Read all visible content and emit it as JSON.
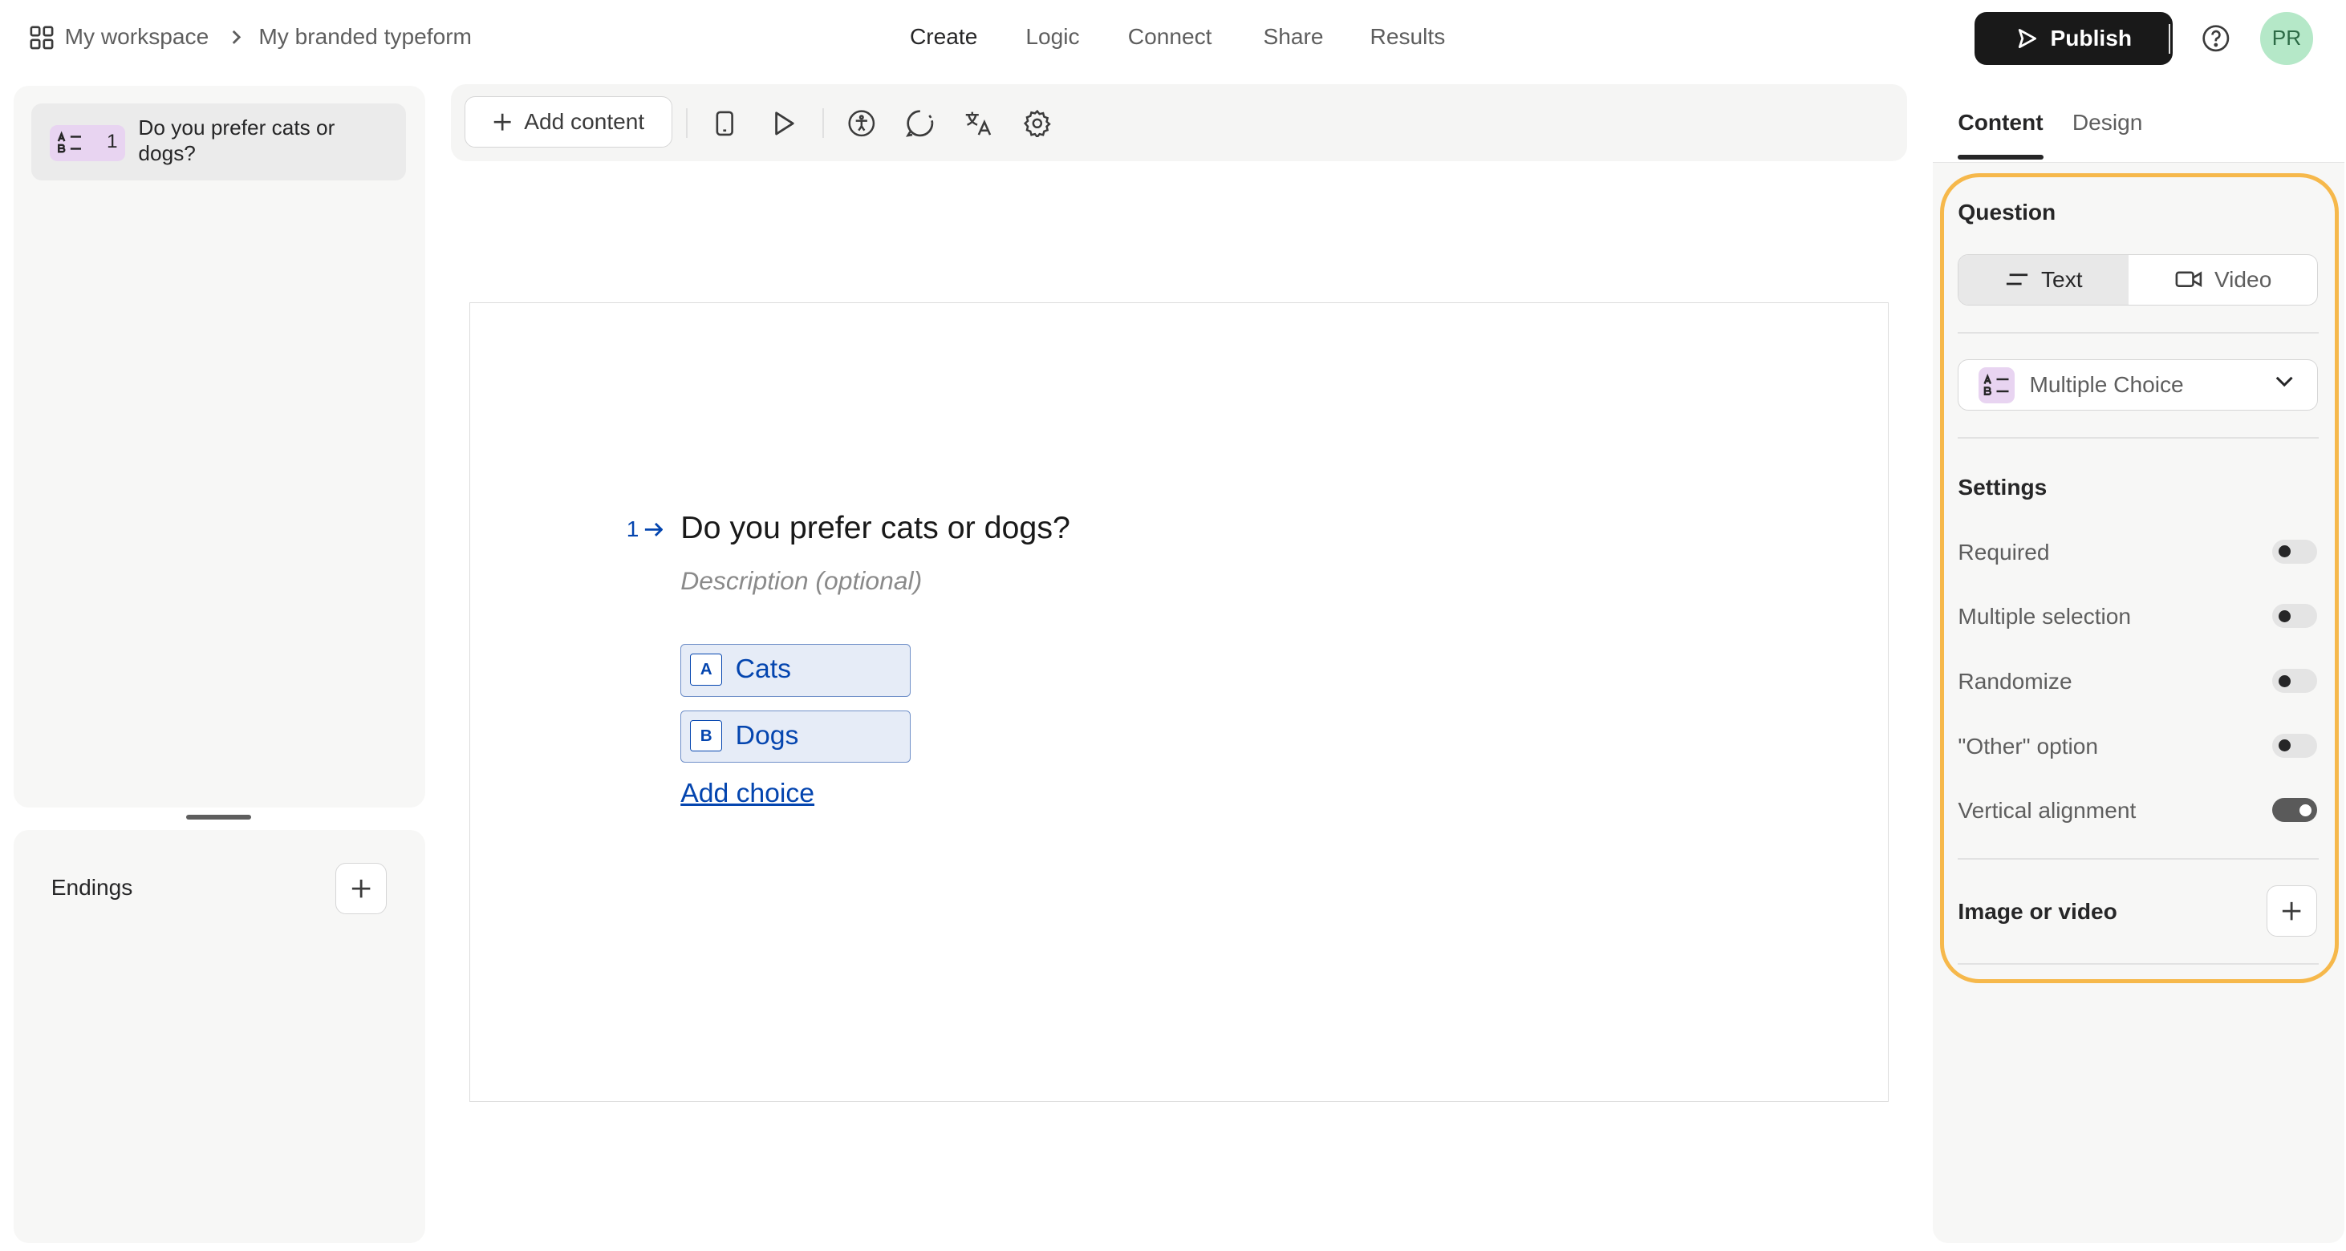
{
  "header": {
    "workspace": "My workspace",
    "form_name": "My branded typeform",
    "nav": [
      "Create",
      "Logic",
      "Connect",
      "Share",
      "Results"
    ],
    "active_nav": "Create",
    "publish_label": "Publish",
    "avatar_initials": "PR"
  },
  "sidebar": {
    "questions": [
      {
        "number": "1",
        "title": "Do you prefer cats or dogs?",
        "type_icon": "multiple-choice-icon"
      }
    ],
    "endings_label": "Endings"
  },
  "toolbar": {
    "add_content_label": "Add content",
    "icons": [
      "mobile-preview-icon",
      "play-icon",
      "accessibility-icon",
      "loading-icon",
      "translate-icon",
      "settings-icon"
    ]
  },
  "question": {
    "number": "1",
    "title": "Do you prefer cats or dogs?",
    "description_placeholder": "Description (optional)",
    "choices": [
      {
        "key": "A",
        "label": "Cats"
      },
      {
        "key": "B",
        "label": "Dogs"
      }
    ],
    "add_choice_label": "Add choice"
  },
  "panel": {
    "tabs": [
      "Content",
      "Design"
    ],
    "active_tab": "Content",
    "question_label": "Question",
    "question_modes": [
      "Text",
      "Video"
    ],
    "active_mode": "Text",
    "question_type": "Multiple Choice",
    "settings_label": "Settings",
    "settings": [
      {
        "label": "Required",
        "on": false
      },
      {
        "label": "Multiple selection",
        "on": false
      },
      {
        "label": "Randomize",
        "on": false
      },
      {
        "label": "\"Other\" option",
        "on": false
      },
      {
        "label": "Vertical alignment",
        "on": true
      }
    ],
    "media_label": "Image or video"
  },
  "colors": {
    "accent": "#0445af",
    "highlight": "#f6b84b",
    "publish_bg": "#191919",
    "type_badge": "#e8d4f1",
    "avatar_bg": "#b5e8c8"
  }
}
